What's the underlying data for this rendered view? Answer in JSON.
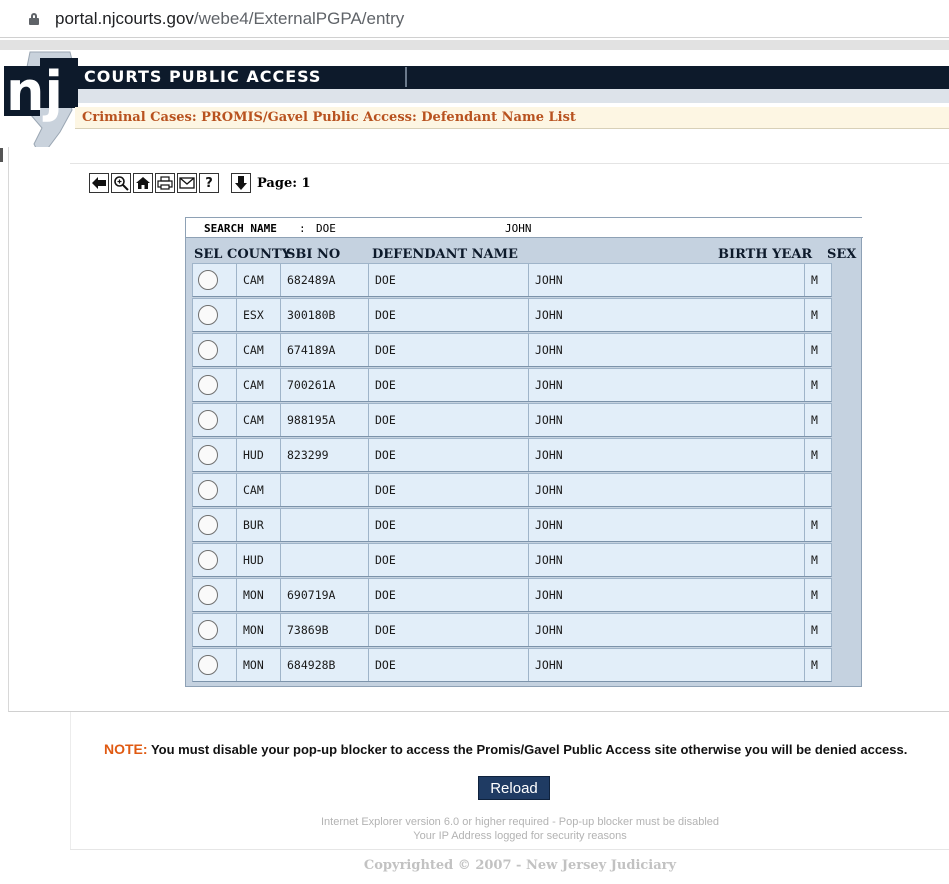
{
  "browser": {
    "url_host": "portal.njcourts.gov",
    "url_path": "/webe4/ExternalPGPA/entry"
  },
  "banner": {
    "logo_text": "nj",
    "title": "COURTS PUBLIC ACCESS",
    "breadcrumb": "Criminal Cases: PROMIS/Gavel Public Access: Defendant Name List"
  },
  "toolbar": {
    "page_label": "Page: 1",
    "help_glyph": "?"
  },
  "search": {
    "label": "SEARCH NAME",
    "separator": ":",
    "last_name": "DOE",
    "first_name": "JOHN"
  },
  "columns": {
    "sel": "SEL",
    "county": "COUNTY",
    "sbi_no": "SBI NO",
    "defendant_name": "DEFENDANT NAME",
    "birth_year": "BIRTH YEAR",
    "sex": "SEX"
  },
  "rows": [
    {
      "county": "CAM",
      "sbi": "682489A",
      "last": "DOE",
      "first": "JOHN",
      "sex": "M"
    },
    {
      "county": "ESX",
      "sbi": "300180B",
      "last": "DOE",
      "first": "JOHN",
      "sex": "M"
    },
    {
      "county": "CAM",
      "sbi": "674189A",
      "last": "DOE",
      "first": "JOHN",
      "sex": "M"
    },
    {
      "county": "CAM",
      "sbi": "700261A",
      "last": "DOE",
      "first": "JOHN",
      "sex": "M"
    },
    {
      "county": "CAM",
      "sbi": "988195A",
      "last": "DOE",
      "first": "JOHN",
      "sex": "M"
    },
    {
      "county": "HUD",
      "sbi": "823299",
      "last": "DOE",
      "first": "JOHN",
      "sex": "M"
    },
    {
      "county": "CAM",
      "sbi": "",
      "last": "DOE",
      "first": "JOHN",
      "sex": ""
    },
    {
      "county": "BUR",
      "sbi": "",
      "last": "DOE",
      "first": "JOHN",
      "sex": "M"
    },
    {
      "county": "HUD",
      "sbi": "",
      "last": "DOE",
      "first": "JOHN",
      "sex": "M"
    },
    {
      "county": "MON",
      "sbi": "690719A",
      "last": "DOE",
      "first": "JOHN",
      "sex": "M"
    },
    {
      "county": "MON",
      "sbi": "73869B",
      "last": "DOE",
      "first": "JOHN",
      "sex": "M"
    },
    {
      "county": "MON",
      "sbi": "684928B",
      "last": "DOE",
      "first": "JOHN",
      "sex": "M"
    }
  ],
  "footer": {
    "note_lead": "NOTE:",
    "note_body": " You must disable your pop-up blocker to access the Promis/Gavel Public Access site otherwise you will be denied access.",
    "reload_label": "Reload",
    "requirement": "Internet Explorer version 6.0 or higher required - Pop-up blocker must be disabled",
    "ip_notice": "Your IP Address logged for security reasons",
    "copyright": "Copyrighted © 2007 - New Jersey Judiciary"
  },
  "colors": {
    "banner_dark": "#0d1a2b",
    "breadcrumb": "#b8521f",
    "row_fill": "#e2eef9",
    "table_frame": "#c5d2e0",
    "note_accent": "#e05a12",
    "reload_button": "#1f3b63"
  }
}
